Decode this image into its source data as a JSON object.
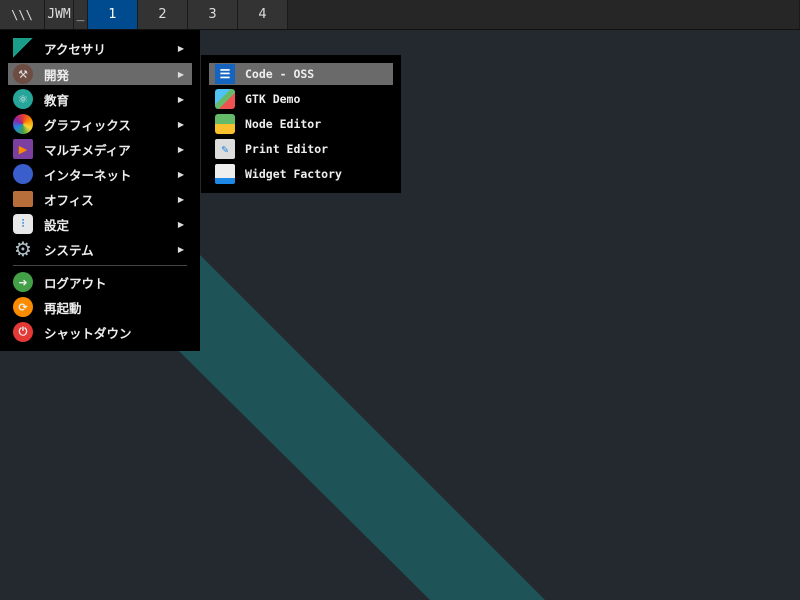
{
  "taskbar": {
    "launcher_label": "\\\\\\",
    "app_label": "JWM",
    "minimize_label": "_",
    "desktops": [
      "1",
      "2",
      "3",
      "4"
    ],
    "active_desktop": "1"
  },
  "menu": {
    "items": [
      {
        "label": "アクセサリ",
        "icon": "accessories-icon",
        "submenu": true
      },
      {
        "label": "開発",
        "icon": "development-hammer-icon",
        "submenu": true,
        "highlighted": true
      },
      {
        "label": "教育",
        "icon": "education-icon",
        "submenu": true
      },
      {
        "label": "グラフィックス",
        "icon": "graphics-icon",
        "submenu": true
      },
      {
        "label": "マルチメディア",
        "icon": "multimedia-icon",
        "submenu": true
      },
      {
        "label": "インターネット",
        "icon": "internet-icon",
        "submenu": true
      },
      {
        "label": "オフィス",
        "icon": "office-briefcase-icon",
        "submenu": true
      },
      {
        "label": "設定",
        "icon": "settings-icon",
        "submenu": true
      },
      {
        "label": "システム",
        "icon": "system-gear-icon",
        "submenu": true
      }
    ],
    "actions": [
      {
        "label": "ログアウト",
        "icon": "logout-icon"
      },
      {
        "label": "再起動",
        "icon": "restart-icon"
      },
      {
        "label": "シャットダウン",
        "icon": "shutdown-icon"
      }
    ],
    "arrow": "▶"
  },
  "submenu": {
    "items": [
      {
        "label": "Code - OSS",
        "icon": "code-oss-icon",
        "highlighted": true
      },
      {
        "label": "GTK Demo",
        "icon": "gtk-cube-icon"
      },
      {
        "label": "Node Editor",
        "icon": "node-editor-icon"
      },
      {
        "label": "Print Editor",
        "icon": "print-editor-icon"
      },
      {
        "label": "Widget Factory",
        "icon": "widget-factory-icon"
      }
    ]
  },
  "colors": {
    "active_desktop": "#004a8f",
    "highlight": "#6a6a6a",
    "teal_band": "#1e5457",
    "desktop_bg": "#23292f"
  }
}
